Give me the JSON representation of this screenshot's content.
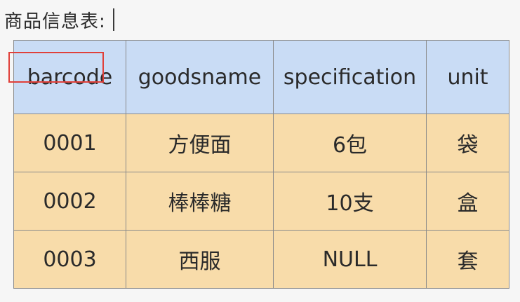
{
  "title": "商品信息表:",
  "table": {
    "columns": [
      "barcode",
      "goodsname",
      "specification",
      "unit"
    ],
    "rows": [
      [
        "0001",
        "方便面",
        "6包",
        "袋"
      ],
      [
        "0002",
        "棒棒糖",
        "10支",
        "盒"
      ],
      [
        "0003",
        "西服",
        "NULL",
        "套"
      ]
    ]
  },
  "colors": {
    "header_bg": "#c9dcf5",
    "body_bg": "#f8dcaa",
    "highlight": "#e0403a"
  }
}
